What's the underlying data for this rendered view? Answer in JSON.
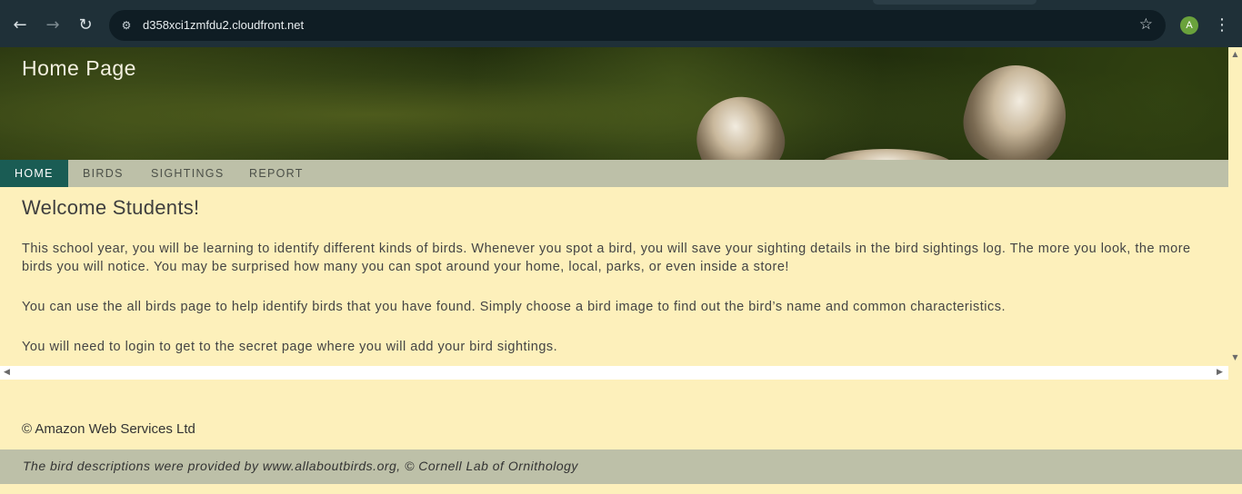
{
  "browser": {
    "url": "d358xci1zmfdu2.cloudfront.net",
    "profile_initial": "A",
    "icons": {
      "back": "arrow-left-icon",
      "forward": "arrow-right-icon",
      "reload": "reload-icon",
      "site_info": "tune-icon",
      "bookmark": "star-icon",
      "menu": "more-vert-icon"
    }
  },
  "header": {
    "title": "Home Page"
  },
  "nav": {
    "items": [
      {
        "label": "HOME",
        "active": true
      },
      {
        "label": "BIRDS",
        "active": false
      },
      {
        "label": "SIGHTINGS",
        "active": false
      },
      {
        "label": "REPORT",
        "active": false
      }
    ]
  },
  "main": {
    "heading": "Welcome Students!",
    "paragraphs": [
      "This school year, you will be learning to identify different kinds of birds. Whenever you spot a bird, you will save your sighting details in the bird sightings log. The more you look, the more birds you will notice. You may be surprised how many you can spot around your home, local, parks, or even inside a store!",
      "You can use the all birds page to help identify birds that you have found. Simply choose a bird image to find out the bird’s name and common characteristics.",
      "You will need to login to get to the secret page where you will add your bird sightings."
    ]
  },
  "footer": {
    "copyright": "© Amazon Web Services Ltd",
    "attribution": "The bird descriptions were provided by www.allaboutbirds.org, © Cornell Lab of Ornithology"
  },
  "colors": {
    "nav_active": "#1a5c54",
    "nav_bar": "#bdc0a8",
    "page_background": "#fdf0bb"
  }
}
